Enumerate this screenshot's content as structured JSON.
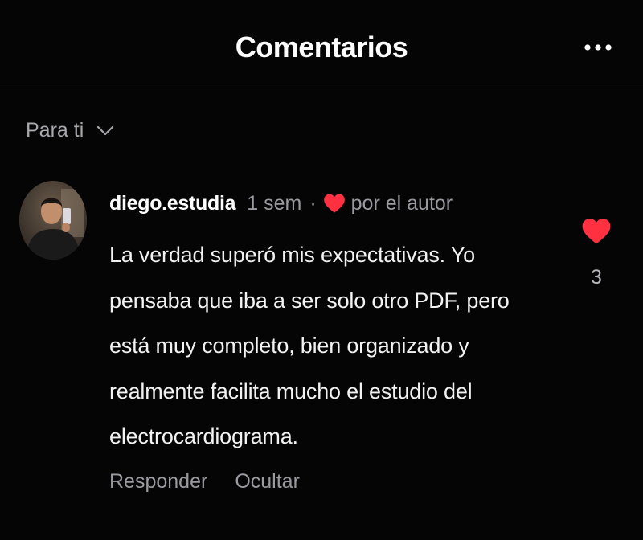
{
  "header": {
    "title": "Comentarios",
    "more_icon": "more-horizontal-icon"
  },
  "filter": {
    "label": "Para ti",
    "icon": "chevron-down-icon"
  },
  "comment": {
    "username": "diego.estudia",
    "time": "1 sem",
    "separator": "·",
    "author_like_icon": "heart-icon",
    "author_like_label": "por el autor",
    "text": "La verdad superó mis expectativas. Yo pensaba que iba a ser solo otro PDF, pero está muy completo, bien organizado y realmente facilita mucho el estudio del electrocardiograma.",
    "actions": {
      "reply": "Responder",
      "hide": "Ocultar"
    },
    "likes": {
      "icon": "heart-filled-icon",
      "count": "3",
      "liked": true
    }
  },
  "colors": {
    "background": "#050506",
    "like_red": "#ff3040",
    "secondary_text": "#9a9aa0"
  }
}
